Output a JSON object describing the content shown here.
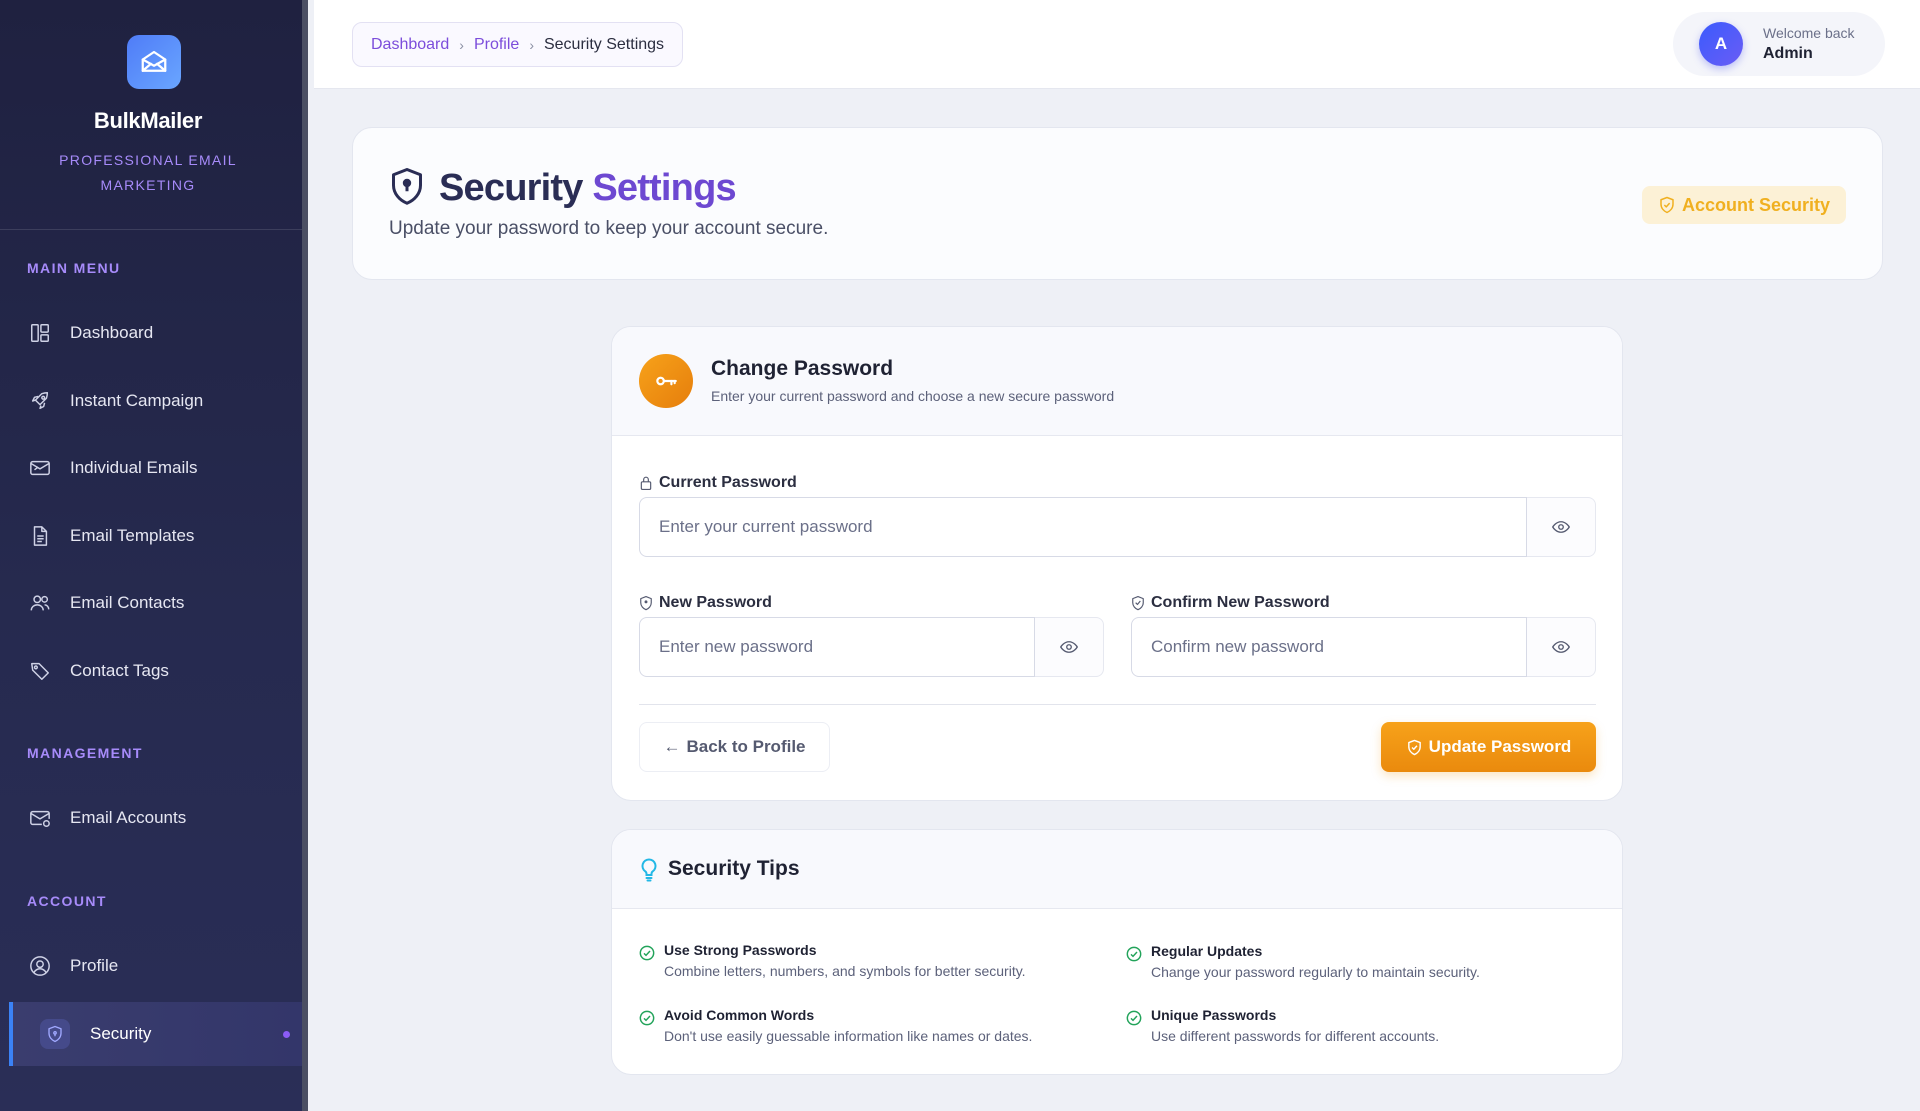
{
  "brand": {
    "name": "BulkMailer",
    "tagline": "PROFESSIONAL EMAIL MARKETING",
    "logo_icon": "mail-envelope-icon",
    "accent_color": "#4f7cf7"
  },
  "sidebar": {
    "sections": [
      {
        "label": "MAIN MENU"
      },
      {
        "label": "MANAGEMENT"
      },
      {
        "label": "ACCOUNT"
      }
    ],
    "items": [
      {
        "label": "Dashboard",
        "icon": "dashboard-icon"
      },
      {
        "label": "Instant Campaign",
        "icon": "rocket-icon"
      },
      {
        "label": "Individual Emails",
        "icon": "mail-icon"
      },
      {
        "label": "Email Templates",
        "icon": "document-icon"
      },
      {
        "label": "Email Contacts",
        "icon": "users-icon"
      },
      {
        "label": "Contact Tags",
        "icon": "tag-icon"
      },
      {
        "label": "Email Accounts",
        "icon": "mail-settings-icon"
      },
      {
        "label": "Profile",
        "icon": "user-circle-icon"
      },
      {
        "label": "Security",
        "icon": "shield-icon",
        "active": true
      }
    ],
    "section_color": "#a78bfa"
  },
  "header": {
    "breadcrumb": [
      "Dashboard",
      "Profile",
      "Security Settings"
    ],
    "user": {
      "welcome": "Welcome back",
      "name": "Admin",
      "avatar_initial": "A"
    }
  },
  "page": {
    "title_part1": "Security",
    "title_part2": "Settings",
    "subtitle": "Update your password to keep your account secure.",
    "badge": "Account Security",
    "badge_color": "#f0b020"
  },
  "change_password": {
    "title": "Change Password",
    "subtitle": "Enter your current password and choose a new secure password",
    "current_label": "Current Password",
    "current_placeholder": "Enter your current password",
    "new_label": "New Password",
    "new_placeholder": "Enter new password",
    "confirm_label": "Confirm New Password",
    "confirm_placeholder": "Confirm new password",
    "back_label": "Back to Profile",
    "submit_label": "Update Password",
    "submit_color": "#f0960f"
  },
  "tips": {
    "title": "Security Tips",
    "items": [
      {
        "title": "Use Strong Passwords",
        "desc": "Combine letters, numbers, and symbols for better security."
      },
      {
        "title": "Regular Updates",
        "desc": "Change your password regularly to maintain security."
      },
      {
        "title": "Avoid Common Words",
        "desc": "Don't use easily guessable information like names or dates."
      },
      {
        "title": "Unique Passwords",
        "desc": "Use different passwords for different accounts."
      }
    ],
    "check_color": "#22a35a"
  }
}
